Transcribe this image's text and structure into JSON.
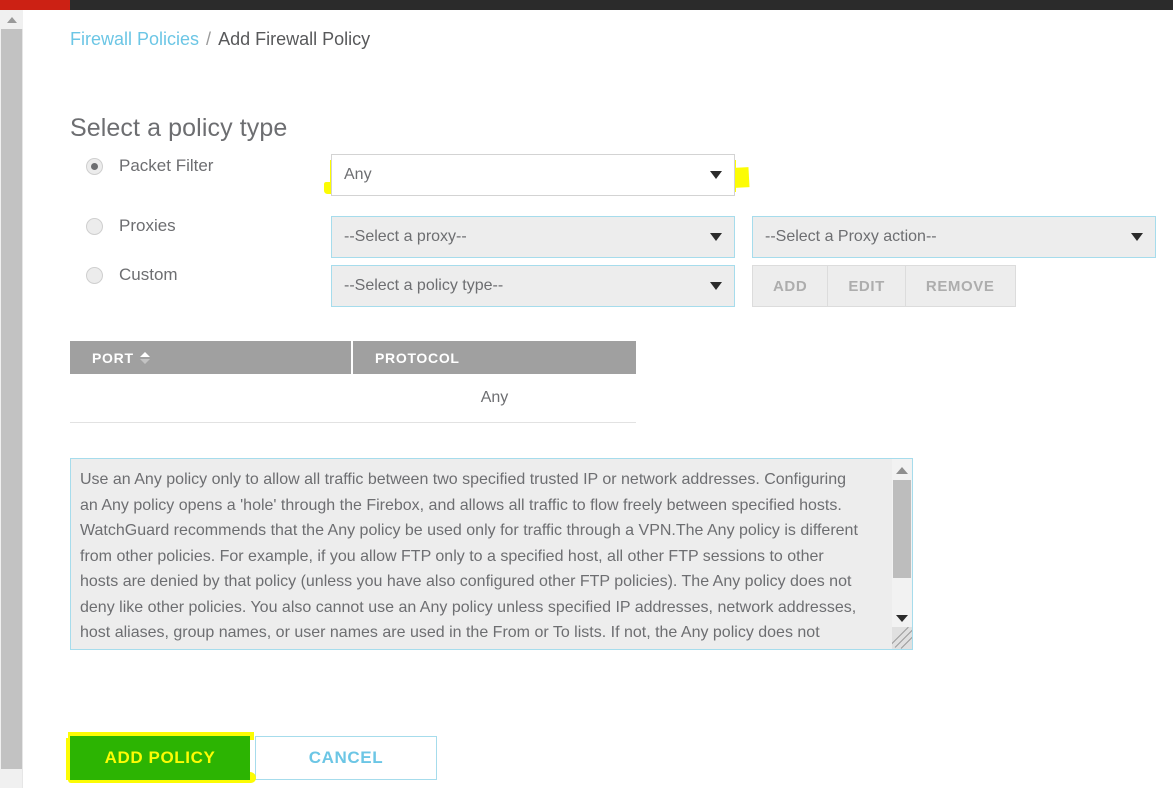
{
  "browser": {
    "tab_accent_color": "#cc2114",
    "chrome_color": "#2b2b2b"
  },
  "breadcrumb": {
    "parent": "Firewall Policies",
    "separator": "/",
    "current": "Add Firewall Policy"
  },
  "page": {
    "title": "Select a policy type"
  },
  "policy_types": [
    {
      "label": "Packet Filter",
      "selected": true
    },
    {
      "label": "Proxies",
      "selected": false
    },
    {
      "label": "Custom",
      "selected": false
    }
  ],
  "selects": {
    "packet_filter": {
      "value": "Any",
      "highlighted": true
    },
    "proxy": {
      "value": "--Select a proxy--"
    },
    "proxy_action": {
      "value": "--Select a Proxy action--"
    },
    "policy_type": {
      "value": "--Select a policy type--"
    }
  },
  "custom_buttons": [
    {
      "label": "ADD"
    },
    {
      "label": "EDIT"
    },
    {
      "label": "REMOVE"
    }
  ],
  "table": {
    "columns": [
      {
        "key": "port",
        "label": "PORT",
        "sortable": true
      },
      {
        "key": "protocol",
        "label": "PROTOCOL",
        "sortable": false
      }
    ],
    "rows": [
      {
        "port": "",
        "protocol": "Any"
      }
    ]
  },
  "description": {
    "text": "Use an Any policy only to allow all traffic between two specified trusted IP or network addresses. Configuring an Any policy opens a 'hole' through the Firebox, and allows all traffic to flow freely between specified hosts. WatchGuard recommends that the Any policy be used only for traffic through a VPN.The Any policy is different from other policies. For example, if you allow FTP only to a specified host, all other FTP sessions to other hosts are denied by that policy (unless you have also configured other FTP policies). The Any policy does not deny like other policies. You also cannot use an Any policy unless specified IP addresses, network addresses, host aliases, group names, or user names are used in the From or To lists. If not, the Any policy does not"
  },
  "footer": {
    "add_policy_label": "ADD POLICY",
    "cancel_label": "CANCEL"
  },
  "colors": {
    "link": "#6cc6e5",
    "text": "#6d6e71",
    "highlighter": "#fcfc04",
    "primary_button": "#2cb402",
    "table_header": "#a0a0a0",
    "field_border": "#a6dcec",
    "field_fill": "#ededed"
  }
}
